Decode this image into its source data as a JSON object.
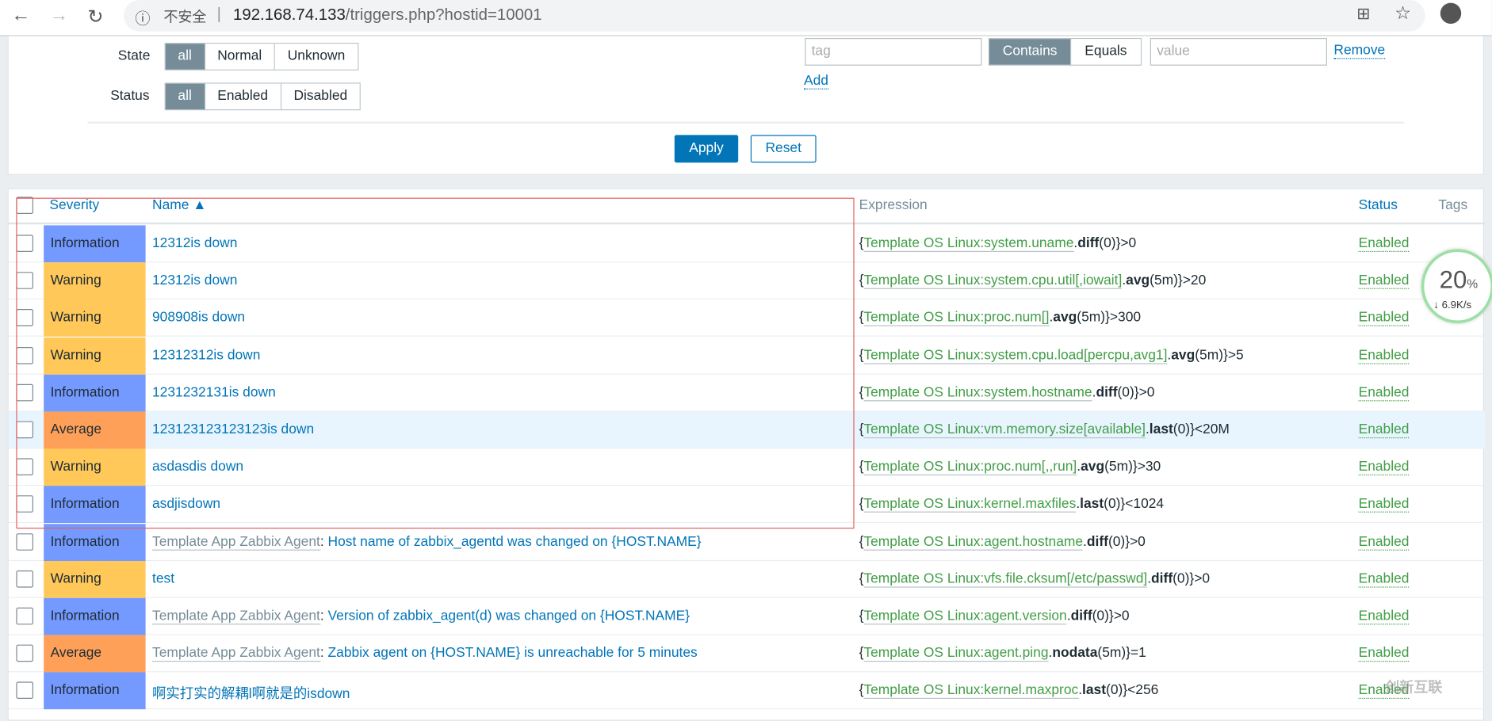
{
  "browser": {
    "insecure_label": "不安全",
    "url_host": "192.168.74.133",
    "url_path": "/triggers.php?hostid=10001"
  },
  "filter": {
    "state_label": "State",
    "state_options": [
      "all",
      "Normal",
      "Unknown"
    ],
    "status_label": "Status",
    "status_options": [
      "all",
      "Enabled",
      "Disabled"
    ],
    "tag_placeholder": "tag",
    "operator_options": [
      "Contains",
      "Equals"
    ],
    "value_placeholder": "value",
    "remove_label": "Remove",
    "add_label": "Add",
    "apply_label": "Apply",
    "reset_label": "Reset"
  },
  "table": {
    "headers": {
      "severity": "Severity",
      "name": "Name ▲",
      "expression": "Expression",
      "status": "Status",
      "tags": "Tags"
    },
    "rows": [
      {
        "severity": "Information",
        "template": "",
        "name": "12312is down",
        "ex": [
          "{",
          "Template OS Linux:system.uname",
          ".",
          "diff",
          "(0)}>0"
        ],
        "status": "Enabled"
      },
      {
        "severity": "Warning",
        "template": "",
        "name": "12312is down",
        "ex": [
          "{",
          "Template OS Linux:system.cpu.util[,iowait]",
          ".",
          "avg",
          "(5m)}>20"
        ],
        "status": "Enabled"
      },
      {
        "severity": "Warning",
        "template": "",
        "name": "908908is down",
        "ex": [
          "{",
          "Template OS Linux:proc.num[]",
          ".",
          "avg",
          "(5m)}>300"
        ],
        "status": "Enabled"
      },
      {
        "severity": "Warning",
        "template": "",
        "name": "12312312is down",
        "ex": [
          "{",
          "Template OS Linux:system.cpu.load[percpu,avg1]",
          ".",
          "avg",
          "(5m)}>5"
        ],
        "status": "Enabled"
      },
      {
        "severity": "Information",
        "template": "",
        "name": "1231232131is down",
        "ex": [
          "{",
          "Template OS Linux:system.hostname",
          ".",
          "diff",
          "(0)}>0"
        ],
        "status": "Enabled"
      },
      {
        "severity": "Average",
        "template": "",
        "name": "123123123123123is down",
        "ex": [
          "{",
          "Template OS Linux:vm.memory.size[available]",
          ".",
          "last",
          "(0)}<20M"
        ],
        "status": "Enabled",
        "highlight": true
      },
      {
        "severity": "Warning",
        "template": "",
        "name": "asdasdis down",
        "ex": [
          "{",
          "Template OS Linux:proc.num[,,run]",
          ".",
          "avg",
          "(5m)}>30"
        ],
        "status": "Enabled"
      },
      {
        "severity": "Information",
        "template": "",
        "name": "asdjisdown",
        "ex": [
          "{",
          "Template OS Linux:kernel.maxfiles",
          ".",
          "last",
          "(0)}<1024"
        ],
        "status": "Enabled"
      },
      {
        "severity": "Information",
        "template": "Template App Zabbix Agent",
        "name": "Host name of zabbix_agentd was changed on {HOST.NAME}",
        "ex": [
          "{",
          "Template OS Linux:agent.hostname",
          ".",
          "diff",
          "(0)}>0"
        ],
        "status": "Enabled"
      },
      {
        "severity": "Warning",
        "template": "",
        "name": "test",
        "ex": [
          "{",
          "Template OS Linux:vfs.file.cksum[/etc/passwd]",
          ".",
          "diff",
          "(0)}>0"
        ],
        "status": "Enabled"
      },
      {
        "severity": "Information",
        "template": "Template App Zabbix Agent",
        "name": "Version of zabbix_agent(d) was changed on {HOST.NAME}",
        "ex": [
          "{",
          "Template OS Linux:agent.version",
          ".",
          "diff",
          "(0)}>0"
        ],
        "status": "Enabled"
      },
      {
        "severity": "Average",
        "template": "Template App Zabbix Agent",
        "name": "Zabbix agent on {HOST.NAME} is unreachable for 5 minutes",
        "ex": [
          "{",
          "Template OS Linux:agent.ping",
          ".",
          "nodata",
          "(5m)}=1"
        ],
        "status": "Enabled"
      },
      {
        "severity": "Information",
        "template": "",
        "name": "啊实打实的解耦l啊就是的isdown",
        "ex": [
          "{",
          "Template OS Linux:kernel.maxproc",
          ".",
          "last",
          "(0)}<256"
        ],
        "status": "Enabled"
      }
    ]
  },
  "severity_colors": {
    "Information": "#7499ff",
    "Warning": "#ffc859",
    "Average": "#ffa059"
  },
  "widget": {
    "percent": "20",
    "unit": "%",
    "speed": "↓ 6.9K/s"
  },
  "watermark": "创新互联"
}
